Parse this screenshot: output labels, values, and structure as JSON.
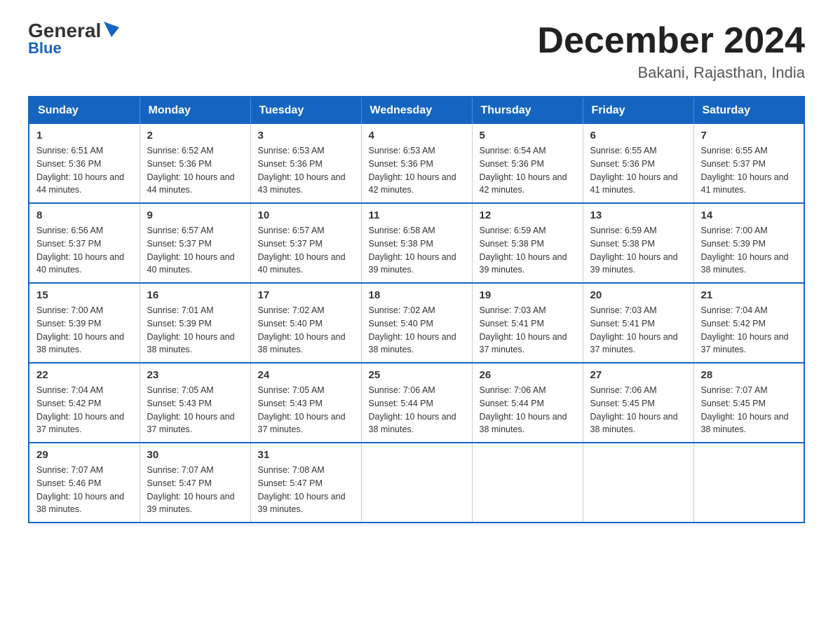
{
  "header": {
    "logo_line1": "General",
    "logo_line2": "Blue",
    "month_year": "December 2024",
    "location": "Bakani, Rajasthan, India"
  },
  "days_of_week": [
    "Sunday",
    "Monday",
    "Tuesday",
    "Wednesday",
    "Thursday",
    "Friday",
    "Saturday"
  ],
  "weeks": [
    [
      {
        "day": "1",
        "sunrise": "6:51 AM",
        "sunset": "5:36 PM",
        "daylight": "10 hours and 44 minutes."
      },
      {
        "day": "2",
        "sunrise": "6:52 AM",
        "sunset": "5:36 PM",
        "daylight": "10 hours and 44 minutes."
      },
      {
        "day": "3",
        "sunrise": "6:53 AM",
        "sunset": "5:36 PM",
        "daylight": "10 hours and 43 minutes."
      },
      {
        "day": "4",
        "sunrise": "6:53 AM",
        "sunset": "5:36 PM",
        "daylight": "10 hours and 42 minutes."
      },
      {
        "day": "5",
        "sunrise": "6:54 AM",
        "sunset": "5:36 PM",
        "daylight": "10 hours and 42 minutes."
      },
      {
        "day": "6",
        "sunrise": "6:55 AM",
        "sunset": "5:36 PM",
        "daylight": "10 hours and 41 minutes."
      },
      {
        "day": "7",
        "sunrise": "6:55 AM",
        "sunset": "5:37 PM",
        "daylight": "10 hours and 41 minutes."
      }
    ],
    [
      {
        "day": "8",
        "sunrise": "6:56 AM",
        "sunset": "5:37 PM",
        "daylight": "10 hours and 40 minutes."
      },
      {
        "day": "9",
        "sunrise": "6:57 AM",
        "sunset": "5:37 PM",
        "daylight": "10 hours and 40 minutes."
      },
      {
        "day": "10",
        "sunrise": "6:57 AM",
        "sunset": "5:37 PM",
        "daylight": "10 hours and 40 minutes."
      },
      {
        "day": "11",
        "sunrise": "6:58 AM",
        "sunset": "5:38 PM",
        "daylight": "10 hours and 39 minutes."
      },
      {
        "day": "12",
        "sunrise": "6:59 AM",
        "sunset": "5:38 PM",
        "daylight": "10 hours and 39 minutes."
      },
      {
        "day": "13",
        "sunrise": "6:59 AM",
        "sunset": "5:38 PM",
        "daylight": "10 hours and 39 minutes."
      },
      {
        "day": "14",
        "sunrise": "7:00 AM",
        "sunset": "5:39 PM",
        "daylight": "10 hours and 38 minutes."
      }
    ],
    [
      {
        "day": "15",
        "sunrise": "7:00 AM",
        "sunset": "5:39 PM",
        "daylight": "10 hours and 38 minutes."
      },
      {
        "day": "16",
        "sunrise": "7:01 AM",
        "sunset": "5:39 PM",
        "daylight": "10 hours and 38 minutes."
      },
      {
        "day": "17",
        "sunrise": "7:02 AM",
        "sunset": "5:40 PM",
        "daylight": "10 hours and 38 minutes."
      },
      {
        "day": "18",
        "sunrise": "7:02 AM",
        "sunset": "5:40 PM",
        "daylight": "10 hours and 38 minutes."
      },
      {
        "day": "19",
        "sunrise": "7:03 AM",
        "sunset": "5:41 PM",
        "daylight": "10 hours and 37 minutes."
      },
      {
        "day": "20",
        "sunrise": "7:03 AM",
        "sunset": "5:41 PM",
        "daylight": "10 hours and 37 minutes."
      },
      {
        "day": "21",
        "sunrise": "7:04 AM",
        "sunset": "5:42 PM",
        "daylight": "10 hours and 37 minutes."
      }
    ],
    [
      {
        "day": "22",
        "sunrise": "7:04 AM",
        "sunset": "5:42 PM",
        "daylight": "10 hours and 37 minutes."
      },
      {
        "day": "23",
        "sunrise": "7:05 AM",
        "sunset": "5:43 PM",
        "daylight": "10 hours and 37 minutes."
      },
      {
        "day": "24",
        "sunrise": "7:05 AM",
        "sunset": "5:43 PM",
        "daylight": "10 hours and 37 minutes."
      },
      {
        "day": "25",
        "sunrise": "7:06 AM",
        "sunset": "5:44 PM",
        "daylight": "10 hours and 38 minutes."
      },
      {
        "day": "26",
        "sunrise": "7:06 AM",
        "sunset": "5:44 PM",
        "daylight": "10 hours and 38 minutes."
      },
      {
        "day": "27",
        "sunrise": "7:06 AM",
        "sunset": "5:45 PM",
        "daylight": "10 hours and 38 minutes."
      },
      {
        "day": "28",
        "sunrise": "7:07 AM",
        "sunset": "5:45 PM",
        "daylight": "10 hours and 38 minutes."
      }
    ],
    [
      {
        "day": "29",
        "sunrise": "7:07 AM",
        "sunset": "5:46 PM",
        "daylight": "10 hours and 38 minutes."
      },
      {
        "day": "30",
        "sunrise": "7:07 AM",
        "sunset": "5:47 PM",
        "daylight": "10 hours and 39 minutes."
      },
      {
        "day": "31",
        "sunrise": "7:08 AM",
        "sunset": "5:47 PM",
        "daylight": "10 hours and 39 minutes."
      },
      null,
      null,
      null,
      null
    ]
  ]
}
